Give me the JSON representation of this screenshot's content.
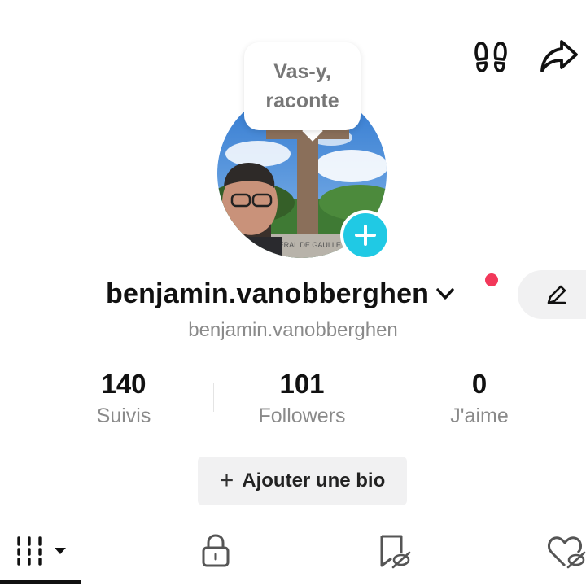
{
  "bubble": {
    "line1": "Vas-y,",
    "line2": "raconte"
  },
  "profile": {
    "username": "benjamin.vanobberghen",
    "handle": "benjamin.vanobberghen"
  },
  "stats": [
    {
      "value": "140",
      "label": "Suivis"
    },
    {
      "value": "101",
      "label": "Followers"
    },
    {
      "value": "0",
      "label": "J'aime"
    }
  ],
  "bio_button": {
    "plus": "+",
    "label": "Ajouter une bio"
  },
  "icons": {
    "footprints": "footprints-icon",
    "share": "share-icon",
    "add": "plus-icon",
    "chevron": "chevron-down-icon",
    "edit": "pencil-icon",
    "grid": "grid-icon",
    "lock": "lock-icon",
    "saved": "bookmark-hidden-icon",
    "liked": "heart-hidden-icon"
  },
  "colors": {
    "accent": "#20c9e4",
    "notification": "#f2385a",
    "muted_text": "#8a8a8a"
  }
}
